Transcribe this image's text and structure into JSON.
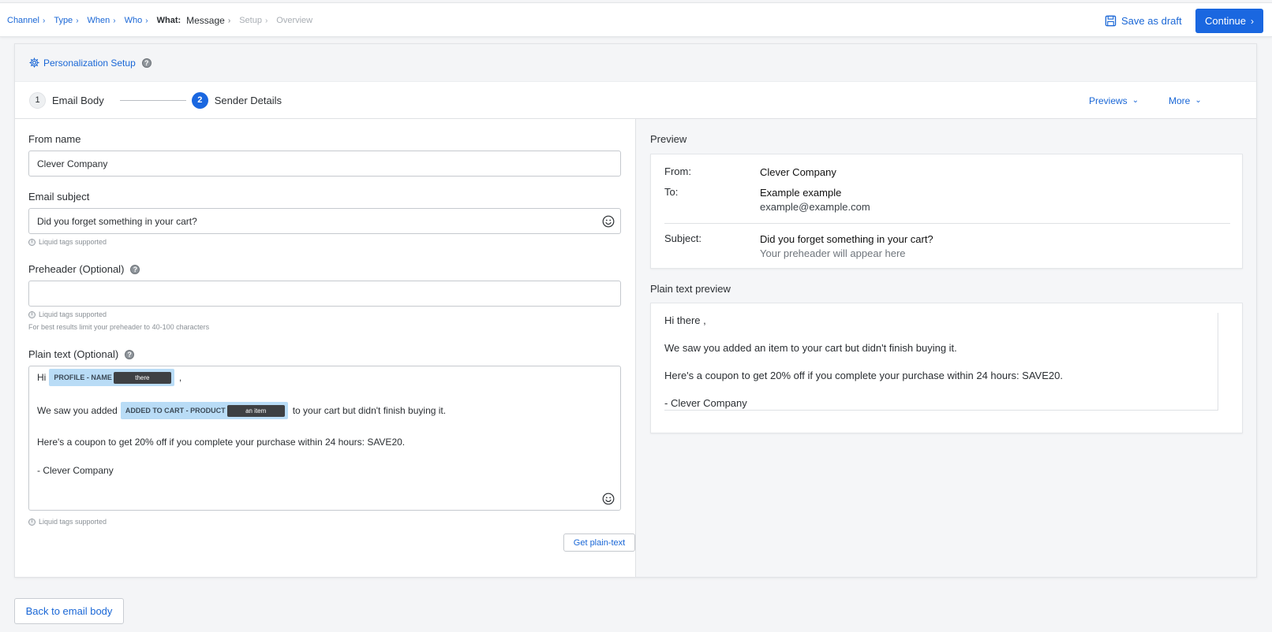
{
  "breadcrumbs": {
    "channel": "Channel",
    "type": "Type",
    "when": "When",
    "who": "Who",
    "what_label": "What:",
    "message": "Message",
    "setup": "Setup",
    "overview": "Overview"
  },
  "toolbar": {
    "save_draft": "Save as draft",
    "continue": "Continue"
  },
  "personalization": {
    "label": "Personalization Setup",
    "help": "?"
  },
  "steps": {
    "step1_num": "1",
    "step1_label": "Email Body",
    "step2_num": "2",
    "step2_label": "Sender Details",
    "previews": "Previews",
    "more": "More"
  },
  "form": {
    "from_name_label": "From name",
    "from_name_value": "Clever Company",
    "subject_label": "Email subject",
    "subject_value": "Did you forget something in your cart?",
    "liquid_hint": "Liquid tags supported",
    "preheader_label": "Preheader (Optional)",
    "preheader_value": "",
    "preheader_hint": "For best results limit your preheader to 40-100 characters",
    "plain_label": "Plain text (Optional)",
    "plain_text": {
      "hi": "Hi",
      "tag1_label": "PROFILE - NAME",
      "tag1_value": "there",
      "comma": ",",
      "line2_start": "We saw you added",
      "tag2_label": "ADDED TO CART - PRODUCT",
      "tag2_value": "an item",
      "line2_end": "to your cart but didn't finish buying it.",
      "line3": "Here's a coupon to get 20% off if you complete your purchase within 24 hours: SAVE20.",
      "line4": "- Clever Company"
    },
    "get_plain_text": "Get plain-text"
  },
  "preview": {
    "title": "Preview",
    "from_key": "From:",
    "from_val": "Clever Company",
    "to_key": "To:",
    "to_name": "Example example",
    "to_email": "example@example.com",
    "subject_key": "Subject:",
    "subject_val": "Did you forget something in your cart?",
    "preheader_placeholder": "Your preheader will appear here"
  },
  "plain_preview": {
    "title": "Plain text preview",
    "line1": "Hi there ,",
    "line2": "We saw you added an item to your cart but didn't finish buying it.",
    "line3": "Here's a coupon to get 20% off if you complete your purchase within 24 hours: SAVE20.",
    "line4": "- Clever Company"
  },
  "footer": {
    "back": "Back to email body"
  },
  "colors": {
    "accent": "#1a67e0",
    "link": "#1a67d6",
    "tag_bg": "#b9dcf6"
  }
}
